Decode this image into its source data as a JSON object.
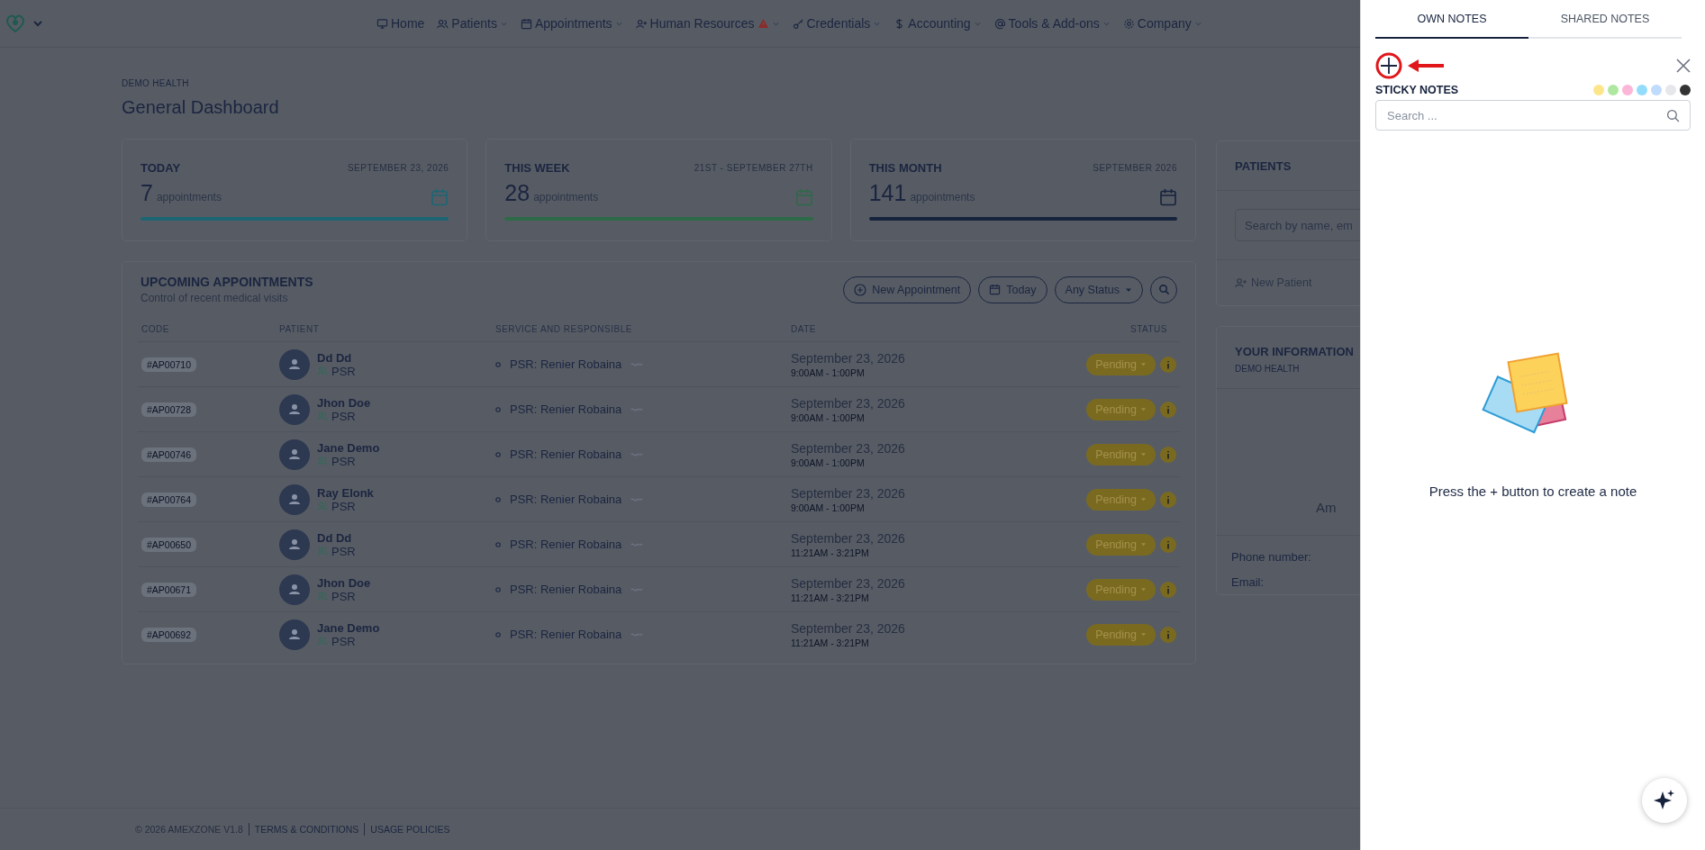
{
  "nav": {
    "items": [
      {
        "label": "Home",
        "dropdown": false,
        "alert": false
      },
      {
        "label": "Patients",
        "dropdown": true,
        "alert": false
      },
      {
        "label": "Appointments",
        "dropdown": true,
        "alert": false
      },
      {
        "label": "Human Resources",
        "dropdown": true,
        "alert": true
      },
      {
        "label": "Credentials",
        "dropdown": true,
        "alert": false
      },
      {
        "label": "Accounting",
        "dropdown": true,
        "alert": false
      },
      {
        "label": "Tools & Add-ons",
        "dropdown": true,
        "alert": false
      },
      {
        "label": "Company",
        "dropdown": true,
        "alert": false
      }
    ]
  },
  "header": {
    "org": "DEMO HEALTH",
    "title": "General Dashboard"
  },
  "stats": [
    {
      "title": "TODAY",
      "date": "SEPTEMBER 23, 2026",
      "count": "7",
      "unit": "appointments",
      "color": "#1d6573"
    },
    {
      "title": "THIS WEEK",
      "date": "21ST - SEPTEMBER 27TH",
      "count": "28",
      "unit": "appointments",
      "color": "#2d6a48"
    },
    {
      "title": "THIS MONTH",
      "date": "SEPTEMBER 2026",
      "count": "141",
      "unit": "appointments",
      "color": "#17233d"
    }
  ],
  "appointments": {
    "title": "UPCOMING APPOINTMENTS",
    "subtitle": "Control of recent medical visits",
    "buttons": [
      {
        "label": "New Appointment",
        "kind": "new"
      },
      {
        "label": "Today",
        "kind": "today"
      },
      {
        "label": "Any Status",
        "kind": "status"
      },
      {
        "kind": "search"
      }
    ],
    "columns": [
      "CODE",
      "PATIENT",
      "SERVICE AND RESPONSIBLE",
      "DATE",
      "STATUS"
    ],
    "rows": [
      {
        "code": "#AP00710",
        "patient": "Dd Dd",
        "role": "PSR",
        "service": "PSR: Renier Robaina",
        "date": "September 23, 2026",
        "time": "9:00AM - 1:00PM",
        "status": "Pending"
      },
      {
        "code": "#AP00728",
        "patient": "Jhon Doe",
        "role": "PSR",
        "service": "PSR: Renier Robaina",
        "date": "September 23, 2026",
        "time": "9:00AM - 1:00PM",
        "status": "Pending"
      },
      {
        "code": "#AP00746",
        "patient": "Jane Demo",
        "role": "PSR",
        "service": "PSR: Renier Robaina",
        "date": "September 23, 2026",
        "time": "9:00AM - 1:00PM",
        "status": "Pending"
      },
      {
        "code": "#AP00764",
        "patient": "Ray Elonk",
        "role": "PSR",
        "service": "PSR: Renier Robaina",
        "date": "September 23, 2026",
        "time": "9:00AM - 1:00PM",
        "status": "Pending"
      },
      {
        "code": "#AP00650",
        "patient": "Dd Dd",
        "role": "PSR",
        "service": "PSR: Renier Robaina",
        "date": "September 23, 2026",
        "time": "11:21AM - 3:21PM",
        "status": "Pending"
      },
      {
        "code": "#AP00671",
        "patient": "Jhon Doe",
        "role": "PSR",
        "service": "PSR: Renier Robaina",
        "date": "September 23, 2026",
        "time": "11:21AM - 3:21PM",
        "status": "Pending"
      },
      {
        "code": "#AP00692",
        "patient": "Jane Demo",
        "role": "PSR",
        "service": "PSR: Renier Robaina",
        "date": "September 23, 2026",
        "time": "11:21AM - 3:21PM",
        "status": "Pending"
      }
    ]
  },
  "patients": {
    "title": "PATIENTS",
    "search": {
      "placeholder": "Search by name, em"
    },
    "new_patient": "New Patient"
  },
  "info": {
    "title": "YOUR INFORMATION",
    "subtitle": "DEMO HEALTH",
    "name": "Am",
    "fields": [
      "Phone number:",
      "Email:"
    ]
  },
  "footer": {
    "copyright": "© 2026 AMEXZONE V1.8",
    "links": [
      "TERMS & CONDITIONS",
      "USAGE POLICIES"
    ]
  },
  "notes": {
    "tabs": [
      {
        "label": "OWN NOTES",
        "selected": true
      },
      {
        "label": "SHARED NOTES",
        "selected": false
      }
    ],
    "title": "STICKY NOTES",
    "colors": [
      {
        "color": "#fde68a"
      },
      {
        "color": "#aee8a0"
      },
      {
        "color": "#fbb6d8"
      },
      {
        "color": "#93dcfc"
      },
      {
        "color": "#bfdbfe"
      },
      {
        "color": "#e5e7eb"
      },
      {
        "color": "#333333"
      }
    ],
    "search": {
      "placeholder": "Search ..."
    },
    "empty_message": "Press the + button to create a note"
  }
}
